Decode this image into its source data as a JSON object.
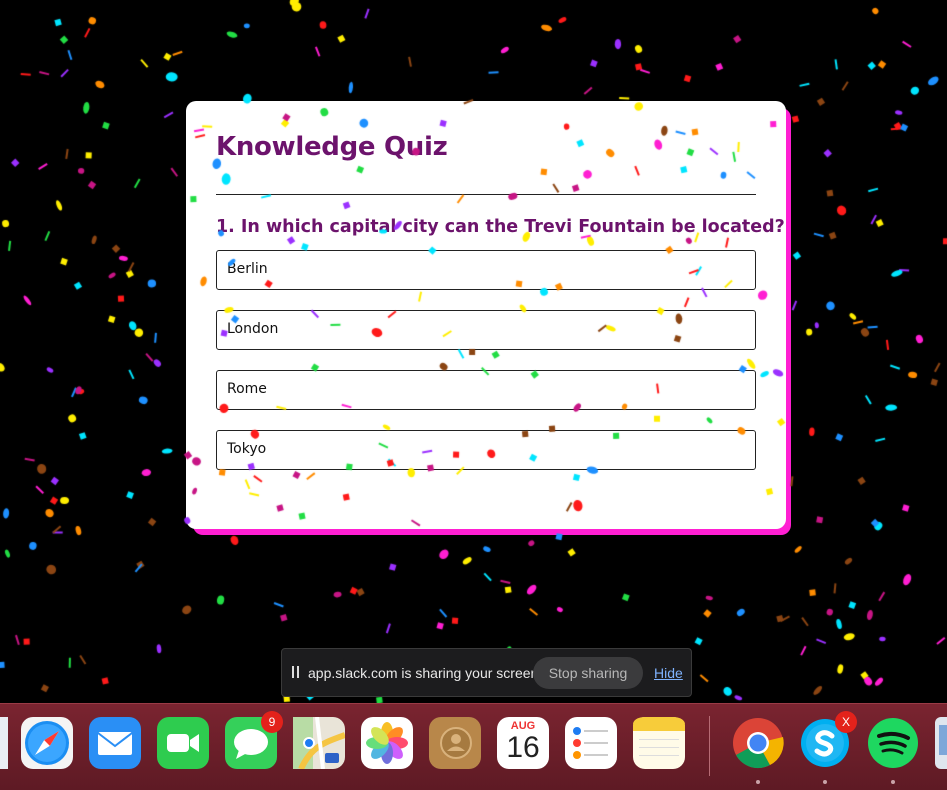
{
  "quiz": {
    "title": "Knowledge Quiz",
    "question": "1. In which capital city can the Trevi Fountain be located?",
    "options": [
      "Berlin",
      "London",
      "Rome",
      "Tokyo"
    ]
  },
  "share_bar": {
    "message": "app.slack.com is sharing your screen.",
    "stop_label": "Stop sharing",
    "hide_label": "Hide"
  },
  "dock": {
    "messages_badge": "9",
    "calendar_month": "AUG",
    "calendar_day": "16",
    "skype_badge": "X",
    "apps": [
      "finder-partial",
      "safari",
      "mail",
      "facetime",
      "messages",
      "maps",
      "photos",
      "contacts",
      "calendar",
      "reminders",
      "notes",
      "chrome",
      "skype",
      "spotify",
      "preview-partial"
    ]
  },
  "colors": {
    "accent": "#6c136c",
    "card_shadow": "#ff1fd2",
    "background": "#000000",
    "dock": "#6e1f2a"
  }
}
